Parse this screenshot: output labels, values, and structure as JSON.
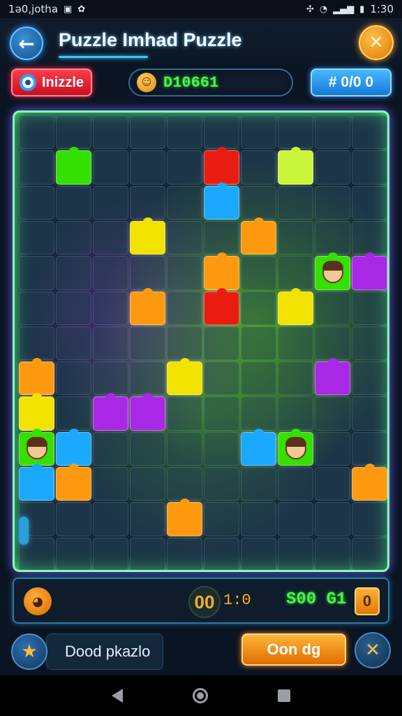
{
  "status_bar": {
    "left_text": "1ǝ0,jotha",
    "time": "1:30"
  },
  "header": {
    "title": "Puzzle Imhad Puzzle",
    "back_icon": "arrow-left-icon",
    "close_icon": "close-icon"
  },
  "toolbar": {
    "mode_label": "Inizzle",
    "score_value": "D10661",
    "count_label": "# 0/0 0"
  },
  "board": {
    "columns": 10,
    "rows": 13,
    "tile_colors": {
      "g": "#35e000",
      "y": "#f2e200",
      "r": "#e81c10",
      "b": "#1aa9ff",
      "o": "#ff9a10",
      "p": "#a928e6",
      "lg": "#c9f53a",
      "dg": "#1e8a20"
    }
  },
  "info_bar": {
    "timer_label": "00",
    "timer_value": "1:0",
    "points_value": "S00 G1",
    "points_badge": "0"
  },
  "action_bar": {
    "hint_label": "Dood pkazlo",
    "primary_label": "Oon dg"
  }
}
